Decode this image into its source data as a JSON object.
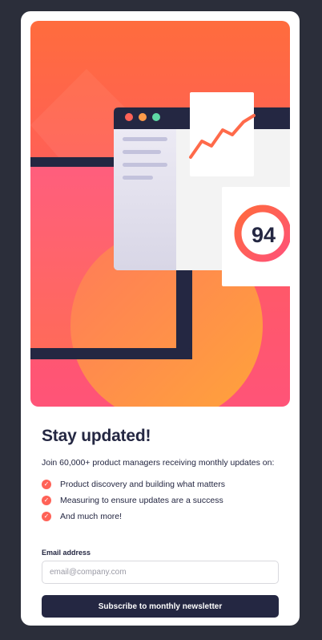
{
  "hero": {
    "score": "94",
    "colors": {
      "gradient_top": "#ff6c3d",
      "gradient_bottom": "#ff5478",
      "navy": "#242742",
      "dot_red": "#ff6257",
      "dot_orange": "#ff9b4a",
      "dot_green": "#5ed9a5"
    }
  },
  "content": {
    "title": "Stay updated!",
    "intro": "Join 60,000+ product managers receiving monthly updates on:",
    "features": [
      "Product discovery and building what matters",
      "Measuring to ensure updates are a success",
      "And much more!"
    ],
    "check_icon": "check-icon"
  },
  "form": {
    "email_label": "Email address",
    "email_placeholder": "email@company.com",
    "email_value": "",
    "submit_label": "Subscribe to monthly newsletter"
  }
}
